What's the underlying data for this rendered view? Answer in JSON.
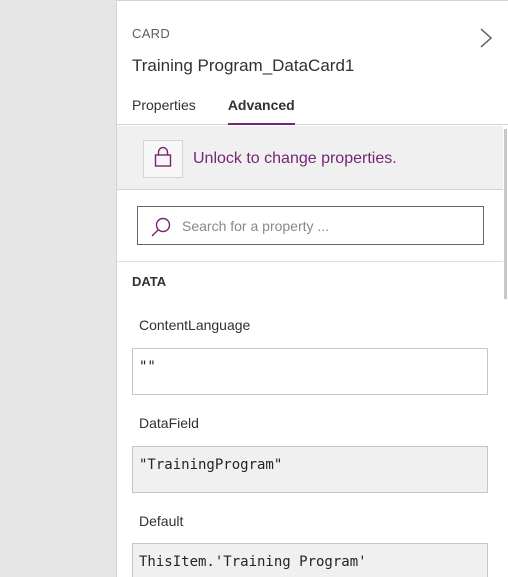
{
  "panel": {
    "kind_label": "CARD",
    "title": "Training Program_DataCard1",
    "tabs": [
      {
        "label": "Properties",
        "active": false
      },
      {
        "label": "Advanced",
        "active": true
      }
    ]
  },
  "lock": {
    "message": "Unlock to change properties."
  },
  "search": {
    "placeholder": "Search for a property ...",
    "value": ""
  },
  "section": {
    "title": "DATA"
  },
  "properties": [
    {
      "label": "ContentLanguage",
      "value": "\"\"",
      "readonly": false
    },
    {
      "label": "DataField",
      "value": "\"TrainingProgram\"",
      "readonly": true
    },
    {
      "label": "Default",
      "value": "ThisItem.'Training Program'",
      "readonly": true
    }
  ],
  "colors": {
    "accent": "#742774",
    "panel_bg": "#ffffff",
    "canvas_bg": "#e6e6e6",
    "readonly_bg": "#f0f0f0"
  },
  "icons": {
    "expand": "chevron-right-icon",
    "lock": "lock-icon",
    "search": "search-icon"
  }
}
